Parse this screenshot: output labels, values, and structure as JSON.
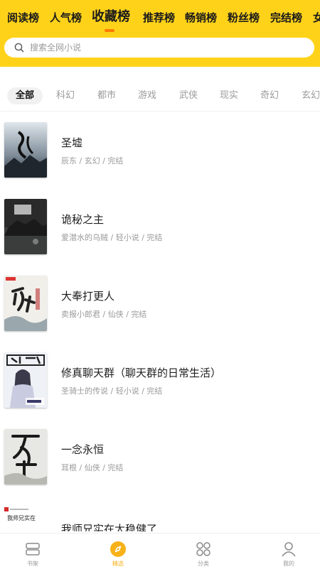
{
  "rank_tabs": [
    {
      "label": "阅读榜"
    },
    {
      "label": "人气榜"
    },
    {
      "label": "收藏榜",
      "active": true
    },
    {
      "label": "推荐榜"
    },
    {
      "label": "畅销榜"
    },
    {
      "label": "粉丝榜"
    },
    {
      "label": "完结榜"
    },
    {
      "label": "女"
    }
  ],
  "search": {
    "placeholder": "搜索全网小说",
    "icon": "search-icon"
  },
  "categories": [
    {
      "label": "全部",
      "active": true
    },
    {
      "label": "科幻"
    },
    {
      "label": "都市"
    },
    {
      "label": "游戏"
    },
    {
      "label": "武侠"
    },
    {
      "label": "现实"
    },
    {
      "label": "奇幻"
    },
    {
      "label": "玄幻"
    }
  ],
  "books": [
    {
      "title": "圣墟",
      "meta": "辰东 / 玄幻 / 完结"
    },
    {
      "title": "诡秘之主",
      "meta": "爱潜水的乌贼 / 轻小说 / 完结"
    },
    {
      "title": "大奉打更人",
      "meta": "卖报小郎君 / 仙侠 / 完结"
    },
    {
      "title": "修真聊天群（聊天群的日常生活）",
      "meta": "圣骑士的传说 / 轻小说 / 完结"
    },
    {
      "title": "一念永恒",
      "meta": "耳根 / 仙侠 / 完结"
    },
    {
      "title": "我师兄实在太稳健了",
      "meta": "",
      "cover_text": "我师兄实在"
    }
  ],
  "tabbar": [
    {
      "label": "书架",
      "icon": "bookshelf-icon"
    },
    {
      "label": "精选",
      "icon": "featured-icon",
      "active": true
    },
    {
      "label": "分类",
      "icon": "category-icon"
    },
    {
      "label": "我的",
      "icon": "user-icon"
    }
  ],
  "colors": {
    "header_bg": "#ffd21a",
    "accent": "#f7b21a",
    "underline": "#ff7a00"
  }
}
